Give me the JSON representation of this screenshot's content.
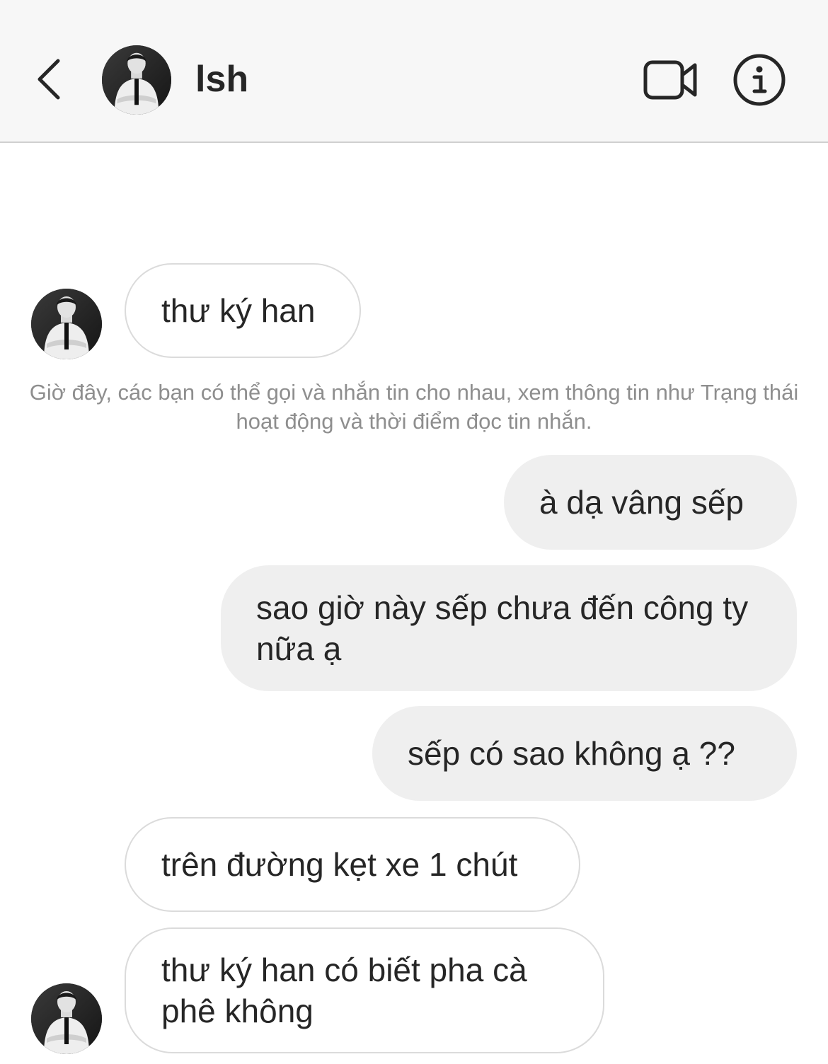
{
  "header": {
    "name": "lsh",
    "back_icon": "chevron-left-icon",
    "video_icon": "video-camera-icon",
    "info_icon": "info-icon"
  },
  "messages": [
    {
      "direction": "incoming",
      "text": "thư ký han"
    },
    {
      "direction": "outgoing",
      "text": "à dạ vâng sếp"
    },
    {
      "direction": "outgoing",
      "text": "sao giờ này sếp chưa đến công ty nữa ạ"
    },
    {
      "direction": "outgoing",
      "text": "sếp có sao không ạ ??"
    },
    {
      "direction": "incoming",
      "text": "trên đường kẹt xe 1 chút"
    },
    {
      "direction": "incoming",
      "text": "thư ký han có biết pha cà phê không"
    }
  ],
  "system_note": "Giờ đây, các bạn có thể gọi và nhắn tin cho nhau, xem thông tin như Trạng thái hoạt động và thời điểm đọc tin nhắn.",
  "colors": {
    "header_bg": "#f7f7f7",
    "outgoing_bubble": "#efefef",
    "incoming_border": "#dbdbdb",
    "system_text": "#8e8e8e"
  }
}
